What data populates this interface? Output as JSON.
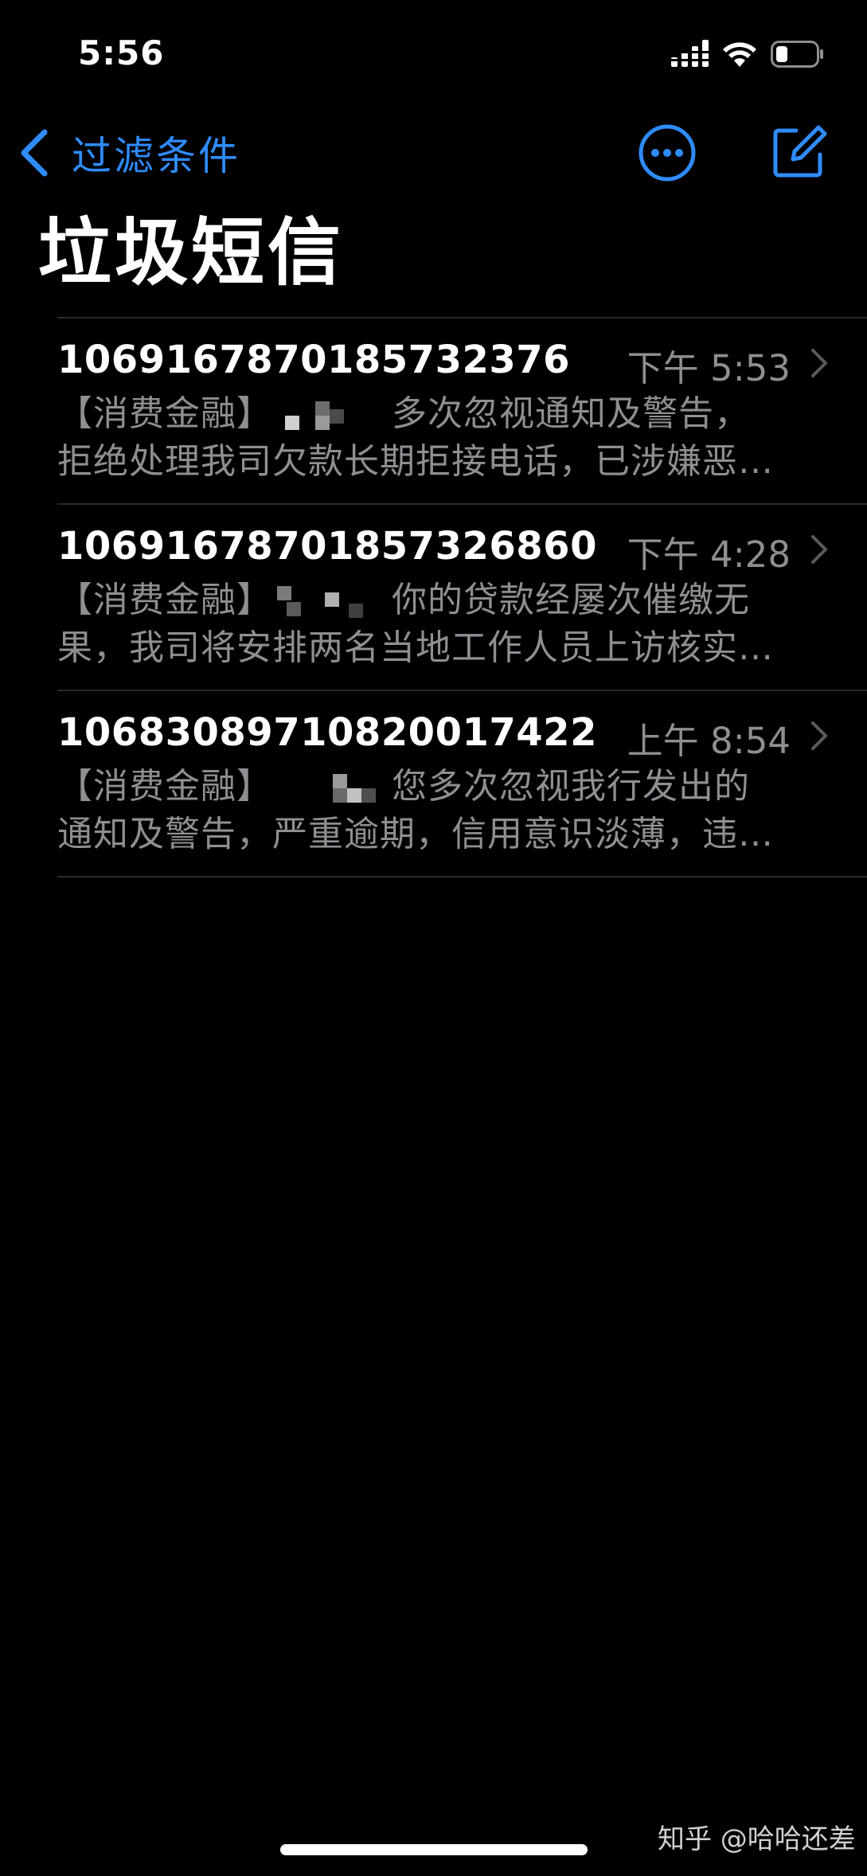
{
  "status_bar": {
    "time": "5:56"
  },
  "nav": {
    "back_label": "过滤条件",
    "more_icon": "ellipsis-circle-icon",
    "compose_icon": "compose-icon",
    "accent_color": "#2f8cff"
  },
  "page_title": "垃圾短信",
  "messages": [
    {
      "sender": "106916787018573237​6",
      "time": "下午 5:53",
      "preview_prefix": "【消费金融】",
      "preview_line1_rest": "多次忽视通知及警告，",
      "preview_line2": "拒绝处理我司欠款长期拒接电话，已涉嫌恶…"
    },
    {
      "sender": "10691678701857326860",
      "time": "下午 4:28",
      "preview_prefix": "【消费金融】",
      "preview_line1_rest": "你的贷款经屡次催缴无",
      "preview_line2": "果，我司将安排两名当地工作人员上访核实…"
    },
    {
      "sender": "10683089710820017422",
      "time": "上午 8:54",
      "preview_prefix": "【消费金融】",
      "preview_line1_rest": "您多次忽视我行发出的",
      "preview_line2": "通知及警告，严重逾期，信用意识淡薄，违…"
    }
  ],
  "watermark": "知乎 @哈哈还差"
}
